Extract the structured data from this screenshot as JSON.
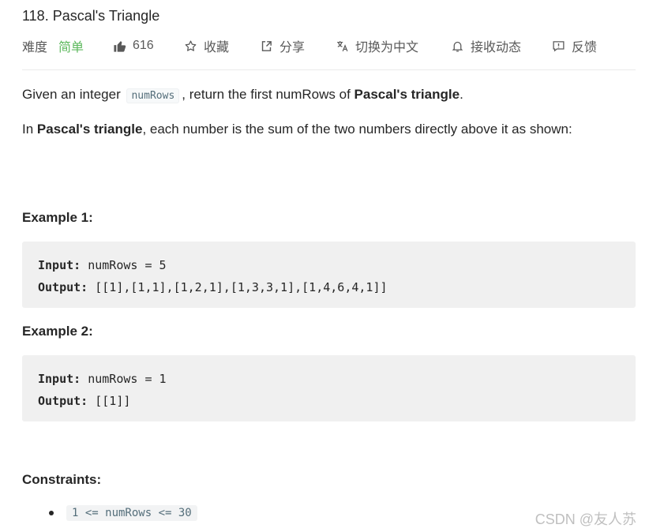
{
  "problem": {
    "title": "118. Pascal's Triangle"
  },
  "meta": {
    "difficulty_label": "难度",
    "difficulty_value": "简单",
    "likes": "616",
    "favorite_label": "收藏",
    "share_label": "分享",
    "switch_lang_label": "切换为中文",
    "notify_label": "接收动态",
    "feedback_label": "反馈",
    "icons": [
      "thumbs-up-icon",
      "star-icon",
      "share-icon",
      "translate-icon",
      "bell-icon",
      "feedback-icon"
    ]
  },
  "description": {
    "p1_part1": "Given an integer",
    "p1_code": "numRows",
    "p1_part2": ", return the first numRows of",
    "p1_bold": "Pascal's triangle",
    "p1_end": ".",
    "p2_part1": "In",
    "p2_bold": "Pascal's triangle",
    "p2_part2": ", each number is the sum of the two numbers directly above it as shown:"
  },
  "examples": [
    {
      "heading": "Example 1:",
      "input_label": "Input:",
      "input_value": "numRows = 5",
      "output_label": "Output:",
      "output_value": "[[1],[1,1],[1,2,1],[1,3,3,1],[1,4,6,4,1]]"
    },
    {
      "heading": "Example 2:",
      "input_label": "Input:",
      "input_value": "numRows = 1",
      "output_label": "Output:",
      "output_value": "[[1]]"
    }
  ],
  "constraints": {
    "heading": "Constraints:",
    "items": [
      "1 <= numRows <= 30"
    ]
  },
  "watermark": "CSDN @友人苏",
  "colors": {
    "difficulty_easy": "#5cb85c",
    "text": "#262626",
    "muted": "#595959",
    "code_bg": "#f0f0f0"
  }
}
